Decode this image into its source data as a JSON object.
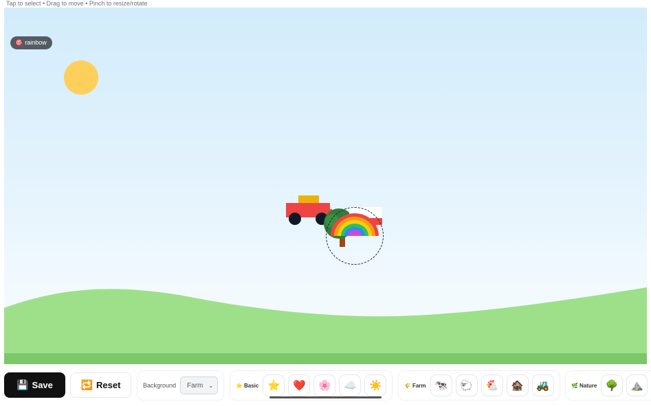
{
  "hint_text": "Tap to select • Drag to move • Pinch to resize/rotate",
  "selected_object": {
    "icon": "🎯",
    "label": "rainbow"
  },
  "toolbar": {
    "save_icon": "💾",
    "save_label": "Save",
    "reset_icon": "🔁",
    "reset_label": "Reset",
    "background_label": "Background",
    "background_value": "Farm",
    "chevron": "⌄",
    "groups": [
      {
        "icon": "⭐",
        "label": "Basic",
        "items": [
          "⭐",
          "❤️",
          "🌸",
          "☁️",
          "☀️"
        ]
      },
      {
        "icon": "🌾",
        "label": "Farm",
        "items": [
          "🐄",
          "🐑",
          "🐔",
          "🏚️",
          "🚜"
        ]
      },
      {
        "icon": "🌿",
        "label": "Nature",
        "items": [
          "🌳",
          "⛰️"
        ]
      }
    ]
  },
  "colors": {
    "sky_top": "#d2ecfb",
    "grass": "#9ee08a",
    "grass_dark": "#7cc76a",
    "sun": "#ffcf5c",
    "tractor_body": "#ef4444",
    "tractor_cab": "#eab308",
    "save_bg": "#111111"
  }
}
